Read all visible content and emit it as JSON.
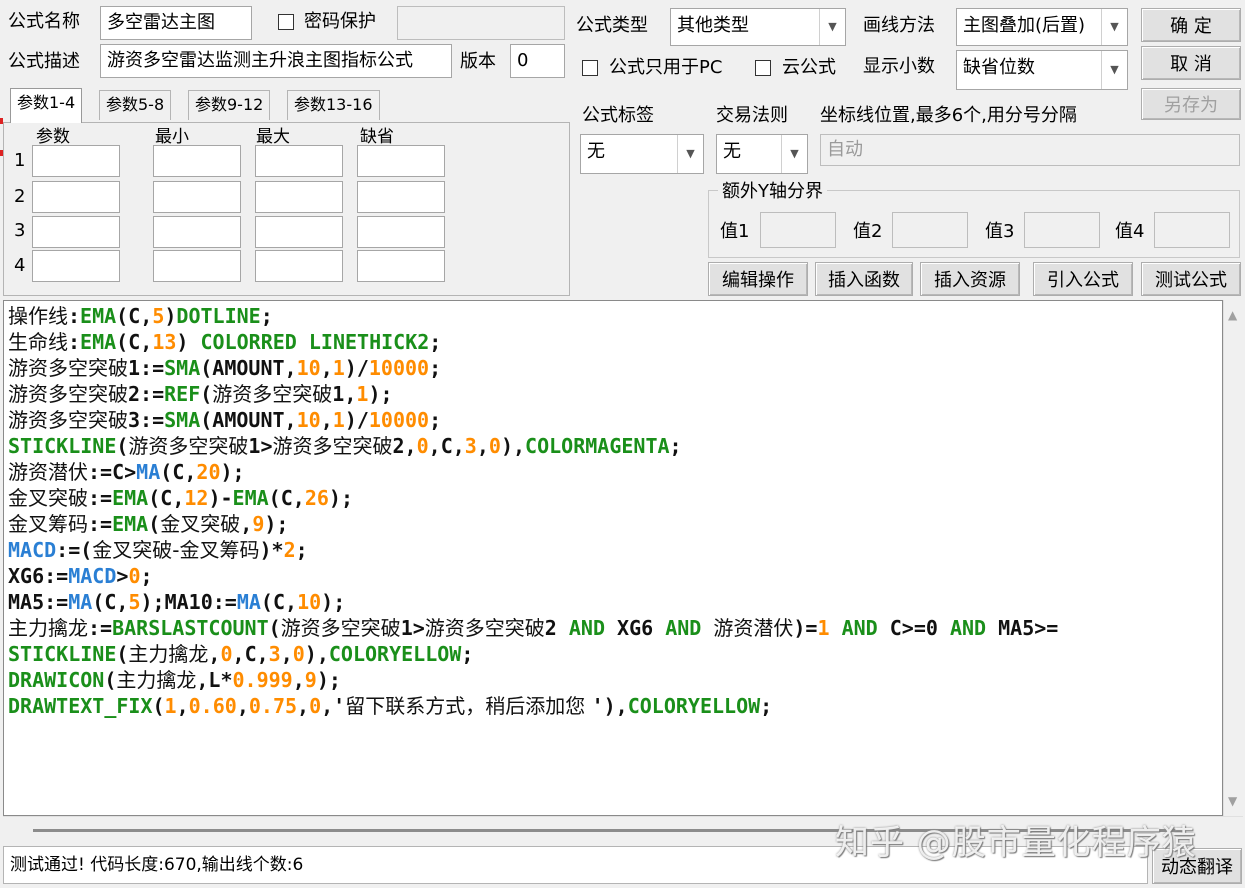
{
  "form": {
    "name_label": "公式名称",
    "name_value": "多空雷达主图",
    "password_label": "密码保护",
    "password_value": "",
    "desc_label": "公式描述",
    "desc_value": "游资多空雷达监测主升浪主图指标公式",
    "version_label": "版本",
    "version_value": "0",
    "type_label": "公式类型",
    "type_value": "其他类型",
    "draw_label": "画线方法",
    "draw_value": "主图叠加(后置)",
    "pc_only_label": "公式只用于PC",
    "cloud_label": "云公式",
    "decimals_label": "显示小数",
    "decimals_value": "缺省位数",
    "tag_label": "公式标签",
    "tag_value": "无",
    "rule_label": "交易法则",
    "rule_value": "无",
    "coord_label": "坐标线位置,最多6个,用分号分隔",
    "coord_value": "自动",
    "extra_y_label": "额外Y轴分界",
    "value_labels": [
      "值1",
      "值2",
      "值3",
      "值4"
    ]
  },
  "buttons": {
    "ok": "确 定",
    "cancel": "取 消",
    "save_as": "另存为",
    "edit_ops": "编辑操作",
    "insert_func": "插入函数",
    "insert_res": "插入资源",
    "import_formula": "引入公式",
    "test_formula": "测试公式",
    "dyn_translate": "动态翻译"
  },
  "params": {
    "tabs": [
      "参数1-4",
      "参数5-8",
      "参数9-12",
      "参数13-16"
    ],
    "columns": [
      "参数",
      "最小",
      "最大",
      "缺省"
    ],
    "rows": [
      "1",
      "2",
      "3",
      "4"
    ]
  },
  "code": [
    [
      [
        "操作线",
        "cn"
      ],
      [
        ":",
        "op"
      ],
      [
        "EMA",
        "fn"
      ],
      [
        "(",
        "op"
      ],
      [
        "C",
        "var"
      ],
      [
        ",",
        "op"
      ],
      [
        "5",
        "num"
      ],
      [
        ")",
        "op"
      ],
      [
        "DOTLINE",
        "kw"
      ],
      [
        ";",
        "op"
      ]
    ],
    [
      [
        "生命线",
        "cn"
      ],
      [
        ":",
        "op"
      ],
      [
        "EMA",
        "fn"
      ],
      [
        "(",
        "op"
      ],
      [
        "C",
        "var"
      ],
      [
        ",",
        "op"
      ],
      [
        "13",
        "num"
      ],
      [
        ") ",
        "op"
      ],
      [
        "COLORRED LINETHICK2",
        "kw"
      ],
      [
        ";",
        "op"
      ]
    ],
    [
      [
        "游资多空突破",
        "cn"
      ],
      [
        "1:=",
        "op"
      ],
      [
        "SMA",
        "fn"
      ],
      [
        "(",
        "op"
      ],
      [
        "AMOUNT",
        "var"
      ],
      [
        ",",
        "op"
      ],
      [
        "10",
        "num"
      ],
      [
        ",",
        "op"
      ],
      [
        "1",
        "num"
      ],
      [
        ")/",
        "op"
      ],
      [
        "10000",
        "num"
      ],
      [
        ";",
        "op"
      ]
    ],
    [
      [
        "游资多空突破",
        "cn"
      ],
      [
        "2:=",
        "op"
      ],
      [
        "REF",
        "fn"
      ],
      [
        "(",
        "op"
      ],
      [
        "游资多空突破",
        "cn"
      ],
      [
        "1",
        "op"
      ],
      [
        ",",
        "op"
      ],
      [
        "1",
        "num"
      ],
      [
        ");",
        "op"
      ]
    ],
    [
      [
        "游资多空突破",
        "cn"
      ],
      [
        "3:=",
        "op"
      ],
      [
        "SMA",
        "fn"
      ],
      [
        "(",
        "op"
      ],
      [
        "AMOUNT",
        "var"
      ],
      [
        ",",
        "op"
      ],
      [
        "10",
        "num"
      ],
      [
        ",",
        "op"
      ],
      [
        "1",
        "num"
      ],
      [
        ")/",
        "op"
      ],
      [
        "10000",
        "num"
      ],
      [
        ";",
        "op"
      ]
    ],
    [
      [
        "STICKLINE",
        "fn"
      ],
      [
        "(",
        "op"
      ],
      [
        "游资多空突破",
        "cn"
      ],
      [
        "1>",
        "op"
      ],
      [
        "游资多空突破",
        "cn"
      ],
      [
        "2,",
        "op"
      ],
      [
        "0",
        "num"
      ],
      [
        ",",
        "op"
      ],
      [
        "C",
        "var"
      ],
      [
        ",",
        "op"
      ],
      [
        "3",
        "num"
      ],
      [
        ",",
        "op"
      ],
      [
        "0",
        "num"
      ],
      [
        "),",
        "op"
      ],
      [
        "COLORMAGENTA",
        "kw"
      ],
      [
        ";",
        "op"
      ]
    ],
    [
      [
        "游资潜伏",
        "cn"
      ],
      [
        ":=C>",
        "op"
      ],
      [
        "MA",
        "blue"
      ],
      [
        "(",
        "op"
      ],
      [
        "C",
        "var"
      ],
      [
        ",",
        "op"
      ],
      [
        "20",
        "num"
      ],
      [
        ");",
        "op"
      ]
    ],
    [
      [
        "金叉突破",
        "cn"
      ],
      [
        ":=",
        "op"
      ],
      [
        "EMA",
        "fn"
      ],
      [
        "(",
        "op"
      ],
      [
        "C",
        "var"
      ],
      [
        ",",
        "op"
      ],
      [
        "12",
        "num"
      ],
      [
        ")-",
        "op"
      ],
      [
        "EMA",
        "fn"
      ],
      [
        "(",
        "op"
      ],
      [
        "C",
        "var"
      ],
      [
        ",",
        "op"
      ],
      [
        "26",
        "num"
      ],
      [
        ");",
        "op"
      ]
    ],
    [
      [
        "金叉筹码",
        "cn"
      ],
      [
        ":=",
        "op"
      ],
      [
        "EMA",
        "fn"
      ],
      [
        "(",
        "op"
      ],
      [
        "金叉突破",
        "cn"
      ],
      [
        ",",
        "op"
      ],
      [
        "9",
        "num"
      ],
      [
        ");",
        "op"
      ]
    ],
    [
      [
        "MACD",
        "blue"
      ],
      [
        ":=(",
        "op"
      ],
      [
        "金叉突破-金叉筹码",
        "cn"
      ],
      [
        ")*",
        "op"
      ],
      [
        "2",
        "num"
      ],
      [
        ";",
        "op"
      ]
    ],
    [
      [
        "XG6:=",
        "op"
      ],
      [
        "MACD",
        "blue"
      ],
      [
        ">",
        "op"
      ],
      [
        "0",
        "num"
      ],
      [
        ";",
        "op"
      ]
    ],
    [
      [
        "MA5:=",
        "op"
      ],
      [
        "MA",
        "blue"
      ],
      [
        "(",
        "op"
      ],
      [
        "C",
        "var"
      ],
      [
        ",",
        "op"
      ],
      [
        "5",
        "num"
      ],
      [
        ");MA10:=",
        "op"
      ],
      [
        "MA",
        "blue"
      ],
      [
        "(",
        "op"
      ],
      [
        "C",
        "var"
      ],
      [
        ",",
        "op"
      ],
      [
        "10",
        "num"
      ],
      [
        ");",
        "op"
      ]
    ],
    [
      [
        "主力擒龙",
        "cn"
      ],
      [
        ":=",
        "op"
      ],
      [
        "BARSLASTCOUNT",
        "fn"
      ],
      [
        "(",
        "op"
      ],
      [
        "游资多空突破",
        "cn"
      ],
      [
        "1>",
        "op"
      ],
      [
        "游资多空突破",
        "cn"
      ],
      [
        "2 ",
        "op"
      ],
      [
        "AND",
        "kw"
      ],
      [
        " XG6 ",
        "op"
      ],
      [
        "AND",
        "kw"
      ],
      [
        " ",
        "op"
      ],
      [
        "游资潜伏",
        "cn"
      ],
      [
        ")=",
        "op"
      ],
      [
        "1",
        "num"
      ],
      [
        " ",
        "op"
      ],
      [
        "AND",
        "kw"
      ],
      [
        " C>=0 ",
        "op"
      ],
      [
        "AND",
        "kw"
      ],
      [
        " MA5>=",
        "op"
      ]
    ],
    [
      [
        "STICKLINE",
        "fn"
      ],
      [
        "(",
        "op"
      ],
      [
        "主力擒龙",
        "cn"
      ],
      [
        ",",
        "op"
      ],
      [
        "0",
        "num"
      ],
      [
        ",",
        "op"
      ],
      [
        "C",
        "var"
      ],
      [
        ",",
        "op"
      ],
      [
        "3",
        "num"
      ],
      [
        ",",
        "op"
      ],
      [
        "0",
        "num"
      ],
      [
        "),",
        "op"
      ],
      [
        "COLORYELLOW",
        "kw"
      ],
      [
        ";",
        "op"
      ]
    ],
    [
      [
        "DRAWICON",
        "fn"
      ],
      [
        "(",
        "op"
      ],
      [
        "主力擒龙",
        "cn"
      ],
      [
        ",",
        "op"
      ],
      [
        "L",
        "var"
      ],
      [
        "*",
        "op"
      ],
      [
        "0.999",
        "num"
      ],
      [
        ",",
        "op"
      ],
      [
        "9",
        "num"
      ],
      [
        ");",
        "op"
      ]
    ],
    [
      [
        "DRAWTEXT_FIX",
        "fn"
      ],
      [
        "(",
        "op"
      ],
      [
        "1",
        "num"
      ],
      [
        ",",
        "op"
      ],
      [
        "0.60",
        "num"
      ],
      [
        ",",
        "op"
      ],
      [
        "0.75",
        "num"
      ],
      [
        ",",
        "op"
      ],
      [
        "0",
        "num"
      ],
      [
        ",'",
        "op"
      ],
      [
        "留下联系方式，稍后添加您 ",
        "str"
      ],
      [
        "'),",
        "op"
      ],
      [
        "COLORYELLOW",
        "kw"
      ],
      [
        ";",
        "op"
      ]
    ]
  ],
  "status": "测试通过! 代码长度:670,输出线个数:6",
  "watermark": "知乎 @股市量化程序猿"
}
